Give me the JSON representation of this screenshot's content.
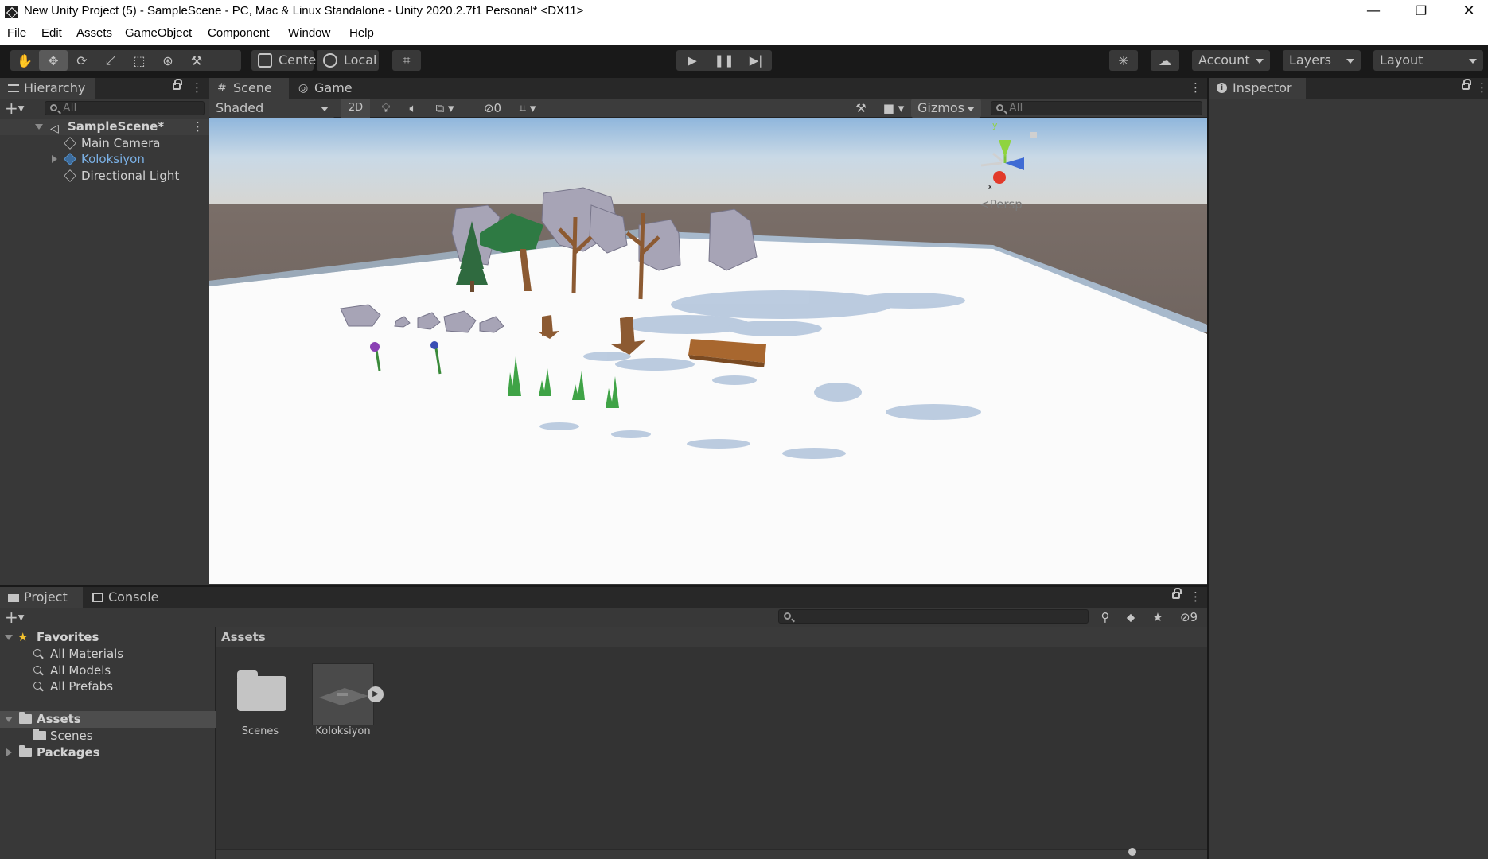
{
  "window": {
    "title": "New Unity Project (5) - SampleScene - PC, Mac & Linux Standalone - Unity 2020.2.7f1 Personal* <DX11>",
    "minimize": "—",
    "maximize": "❐",
    "close": "✕"
  },
  "menu": [
    "File",
    "Edit",
    "Assets",
    "GameObject",
    "Component",
    "Window",
    "Help"
  ],
  "toolbar": {
    "pivot_label": "Center",
    "space_label": "Local",
    "account_label": "Account",
    "layers_label": "Layers",
    "layout_label": "Layout"
  },
  "hierarchy": {
    "tab_label": "Hierarchy",
    "search_placeholder": "All",
    "scene_name": "SampleScene*",
    "items": [
      {
        "label": "Main Camera"
      },
      {
        "label": "Koloksiyon"
      },
      {
        "label": "Directional Light"
      }
    ]
  },
  "scene": {
    "tab_scene": "Scene",
    "tab_game": "Game",
    "shading_mode": "Shaded",
    "mode_2d": "2D",
    "hidden_count": "0",
    "gizmos_label": "Gizmos",
    "search_placeholder": "All",
    "persp_label": "Persp",
    "axis_x": "x",
    "axis_y": "y"
  },
  "inspector": {
    "tab_label": "Inspector"
  },
  "project": {
    "tab_project": "Project",
    "tab_console": "Console",
    "hidden_count": "9",
    "breadcrumb": "Assets",
    "favorites_label": "Favorites",
    "favorites": [
      "All Materials",
      "All Models",
      "All Prefabs"
    ],
    "assets_label": "Assets",
    "asset_folders": [
      "Scenes"
    ],
    "packages_label": "Packages",
    "grid_items": [
      {
        "label": "Scenes",
        "type": "folder"
      },
      {
        "label": "Koloksiyon",
        "type": "prefab"
      }
    ]
  }
}
